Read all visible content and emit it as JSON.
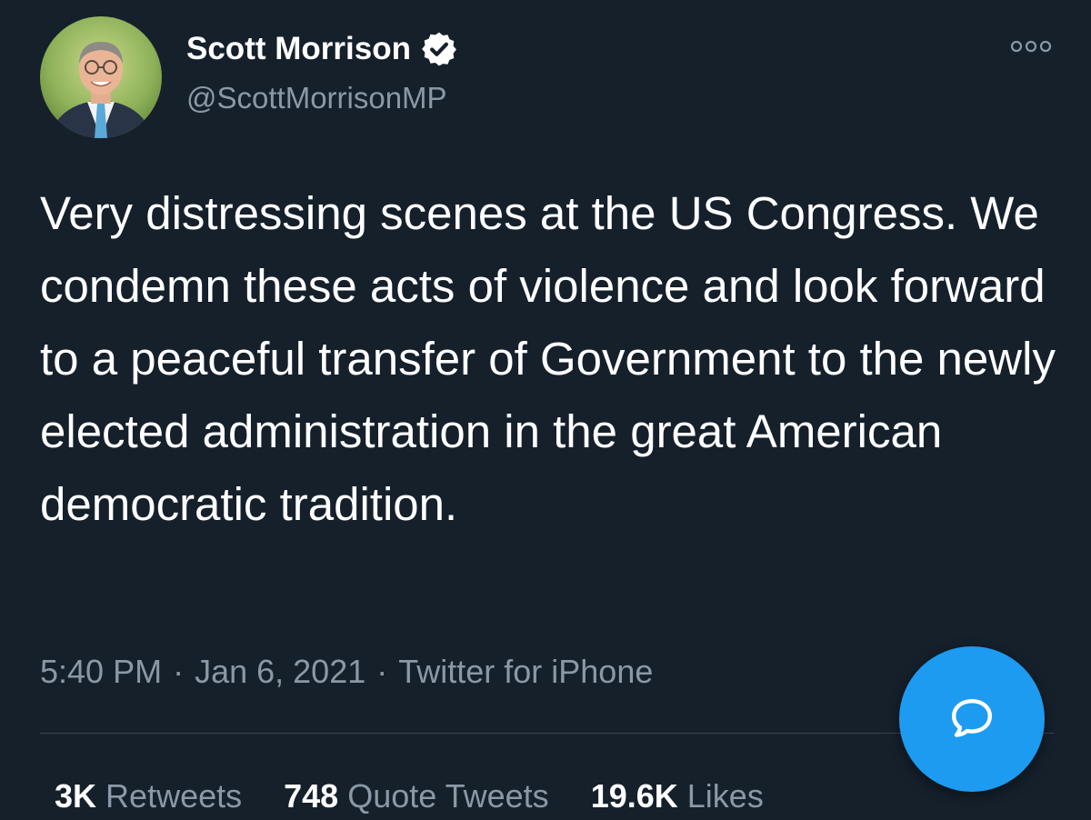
{
  "author": {
    "display_name": "Scott Morrison",
    "handle": "@ScottMorrisonMP",
    "verified": true
  },
  "tweet": {
    "text": "Very distressing scenes at the US Congress. We condemn these acts of violence and look forward to a peaceful transfer of Government to the newly elected administration in the great American democratic tradition.",
    "time": "5:40 PM",
    "date": "Jan 6, 2021",
    "source": "Twitter for iPhone"
  },
  "stats": {
    "retweets_count": "3K",
    "retweets_label": "Retweets",
    "quotes_count": "748",
    "quotes_label": "Quote Tweets",
    "likes_count": "19.6K",
    "likes_label": "Likes"
  },
  "icons": {
    "verified": "verified-badge-icon",
    "more": "more-options-icon",
    "compose": "reply-bubble-icon"
  },
  "colors": {
    "background": "#15202b",
    "accent": "#1d9bf0",
    "secondary_text": "#8b98a5"
  }
}
